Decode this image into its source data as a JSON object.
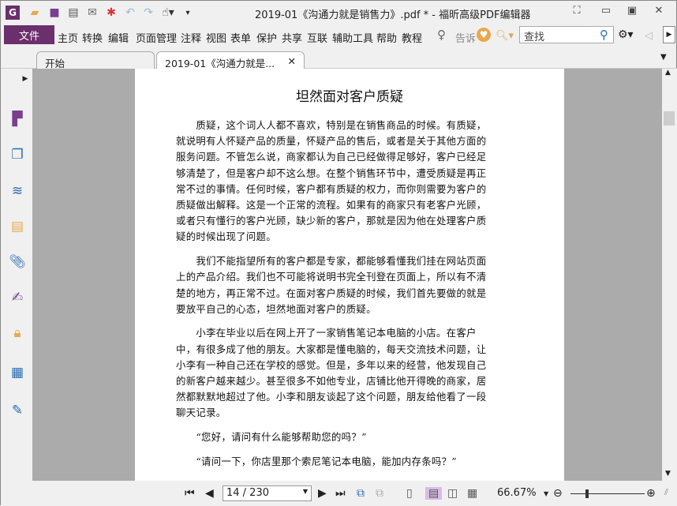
{
  "window": {
    "title": "2019-01《沟通力就是销售力》.pdf * - 福昕高级PDF编辑器"
  },
  "quick_access": [
    "app-logo",
    "open-icon",
    "save-icon",
    "print-icon",
    "email-icon",
    "new-icon",
    "undo-icon",
    "redo-icon",
    "hand-tool-icon"
  ],
  "menu": {
    "file": "文件",
    "items": [
      "主页",
      "转换",
      "编辑",
      "页面管理",
      "注释",
      "视图",
      "表单",
      "保护",
      "共享",
      "互联",
      "辅助工具",
      "帮助",
      "教程"
    ],
    "tell_me": "告诉",
    "search_placeholder": "查找"
  },
  "tabs": [
    {
      "label": "开始"
    },
    {
      "label": "2019-01《沟通力就是...",
      "close": "✕"
    }
  ],
  "document": {
    "title": "坦然面对客户质疑",
    "paragraphs": [
      [
        "　　质疑，这个词人人都不喜欢，特别是在销售商品的时候。有质疑，",
        "就说明有人怀疑产品的质量，怀疑产品的售后，或者是关于其他方面的",
        "服务问题。不管怎么说，商家都认为自己已经做得足够好，客户已经足",
        "够清楚了，但是客户却不这么想。在整个销售环节中，遭受质疑是再正",
        "常不过的事情。任何时候，客户都有质疑的权力，而你则需要为客户的",
        "质疑做出解释。这是一个正常的流程。如果有的商家只有老客户光顾，",
        "或者只有懂行的客户光顾，缺少新的客户，那就是因为他在处理客户质",
        "疑的时候出现了问题。"
      ],
      [
        "　　我们不能指望所有的客户都是专家，都能够看懂我们挂在网站页面",
        "上的产品介绍。我们也不可能将说明书完全刊登在页面上，所以有不清",
        "楚的地方，再正常不过。在面对客户质疑的时候，我们首先要做的就是",
        "要放平自己的心态，坦然地面对客户的质疑。"
      ],
      [
        "　　小李在毕业以后在网上开了一家销售笔记本电脑的小店。在客户",
        "中，有很多成了他的朋友。大家都是懂电脑的，每天交流技术问题，让",
        "小李有一种自己还在学校的感觉。但是，多年以来的经营，他发现自己",
        "的新客户越来越少。甚至很多不如他专业，店铺比他开得晚的商家，居",
        "然都默默地超过了他。小李和朋友谈起了这个问题，朋友给他看了一段",
        "聊天记录。"
      ],
      [
        "　　“您好，请问有什么能够帮助您的吗？”"
      ],
      [
        "　　“请问一下，你店里那个索尼笔记本电脑，能加内存条吗？”"
      ]
    ]
  },
  "status": {
    "page": "14 / 230",
    "zoom": "66.67%",
    "zoom_level_percent": 66.67
  }
}
